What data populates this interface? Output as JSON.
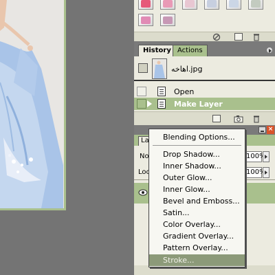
{
  "history": {
    "tabs": [
      "History",
      "Actions"
    ],
    "snapshot_name": "اهاخه.jpg",
    "steps": [
      "Open",
      "Make Layer"
    ]
  },
  "layers": {
    "tab_label": "La",
    "blend_label": "No",
    "opacity_value": "100%",
    "lock_label": "Loc",
    "fill_value": "100%"
  },
  "context_menu": {
    "items": [
      "Blending Options...",
      "Drop Shadow...",
      "Inner Shadow...",
      "Outer Glow...",
      "Inner Glow...",
      "Bevel and Emboss...",
      "Satin...",
      "Color Overlay...",
      "Gradient Overlay...",
      "Pattern Overlay...",
      "Stroke..."
    ],
    "highlighted": "Stroke..."
  },
  "colors": {
    "panel_bg": "#ecebe0",
    "accent_green": "#a9c08d",
    "highlight": "#8c9a79",
    "workspace": "#747474",
    "dress_blue": "#b7cfee"
  },
  "icons": [
    "history-brush-icon",
    "layer-state-icon",
    "eye-icon",
    "close-icon",
    "minimize-icon",
    "panel-menu-arrow-icon",
    "trash-icon",
    "camera-icon",
    "new-document-icon"
  ]
}
